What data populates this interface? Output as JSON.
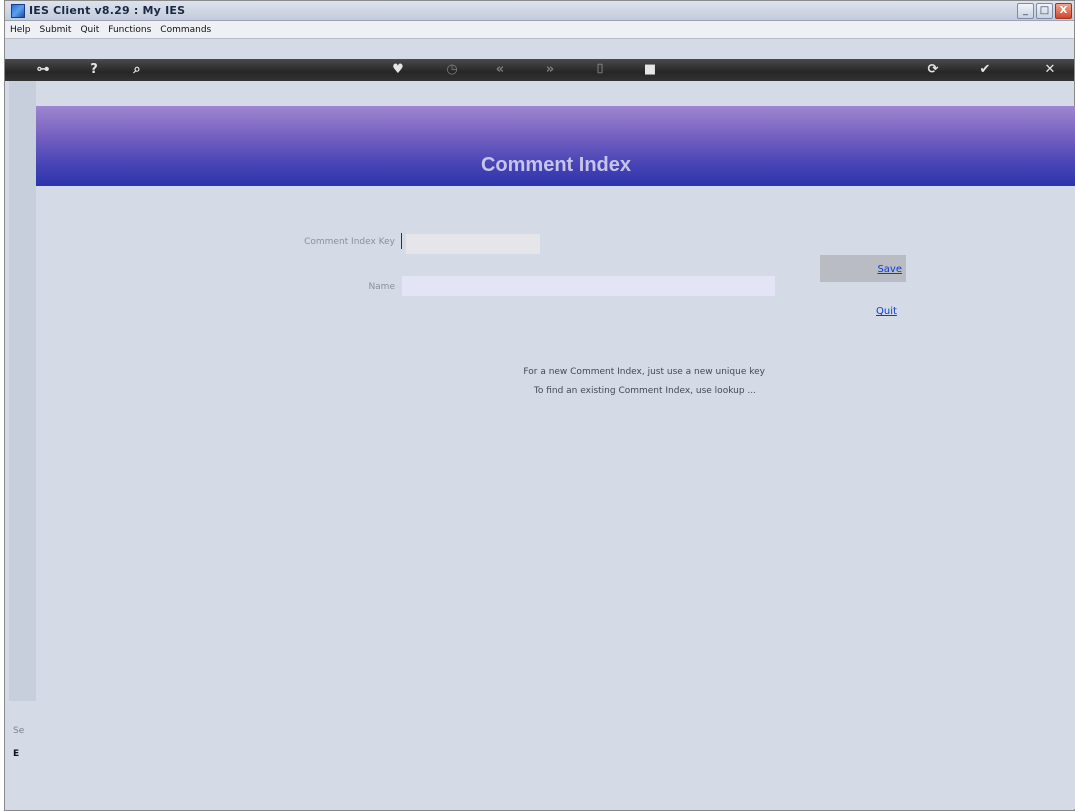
{
  "window": {
    "title": "IES Client v8.29 : My IES",
    "controls": {
      "minimize": "_",
      "maximize": "□",
      "close": "X"
    }
  },
  "menu": {
    "items": [
      "Help",
      "Submit",
      "Quit",
      "Functions",
      "Commands"
    ]
  },
  "toolbar": {
    "icons": [
      {
        "name": "key-icon",
        "glyph": "⊶"
      },
      {
        "name": "help-icon",
        "glyph": "?"
      },
      {
        "name": "search-icon",
        "glyph": "⌕"
      },
      {
        "name": "heart-icon",
        "glyph": "♥"
      },
      {
        "name": "clock-icon",
        "glyph": "◷"
      },
      {
        "name": "previous-icon",
        "glyph": "«"
      },
      {
        "name": "next-icon",
        "glyph": "»"
      },
      {
        "name": "bookmark-icon",
        "glyph": "⌷"
      },
      {
        "name": "stop-icon",
        "glyph": "■"
      },
      {
        "name": "refresh-icon",
        "glyph": "⟳"
      },
      {
        "name": "check-icon",
        "glyph": "✔"
      },
      {
        "name": "close-icon",
        "glyph": "✕"
      }
    ]
  },
  "form": {
    "title": "Comment Index",
    "key_label": "Comment Index Key",
    "key_value": "",
    "name_label": "Name",
    "name_value": "",
    "save_label": "Save",
    "quit_label": "Quit",
    "hint_line1": "For a new Comment Index, just use a new unique key",
    "hint_line2": "To find an existing Comment Index, use lookup ..."
  },
  "left_strip": {
    "marks": [
      "Se",
      "E"
    ]
  }
}
